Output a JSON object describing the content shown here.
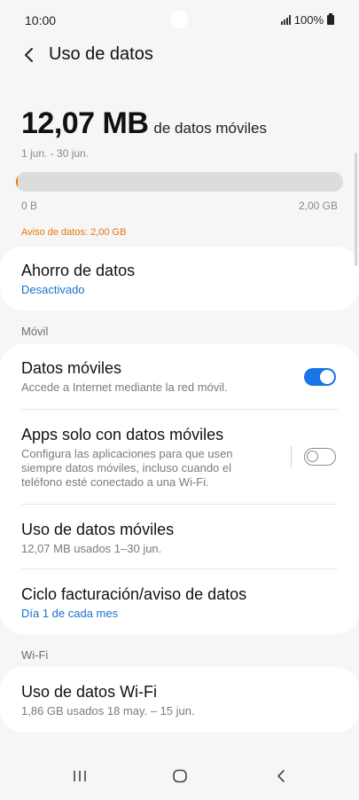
{
  "status": {
    "time": "10:00",
    "battery": "100%"
  },
  "header": {
    "title": "Uso de datos"
  },
  "usage": {
    "amount": "12,07 MB",
    "unit_text": "de datos móviles",
    "period": "1 jun. - 30 jun.",
    "progress_fraction": 0.006,
    "bar_min": "0 B",
    "bar_max": "2,00 GB",
    "warning": "Aviso de datos: 2,00 GB"
  },
  "data_saver": {
    "title": "Ahorro de datos",
    "status": "Desactivado"
  },
  "mobile": {
    "section_label": "Móvil",
    "mobile_data": {
      "title": "Datos móviles",
      "subtitle": "Accede a Internet mediante la red móvil.",
      "enabled": true
    },
    "mobile_only_apps": {
      "title": "Apps solo con datos móviles",
      "subtitle": "Configura las aplicaciones para que usen siempre datos móviles, incluso cuando el teléfono esté conectado a una Wi-Fi.",
      "enabled": false
    },
    "mobile_usage": {
      "title": "Uso de datos móviles",
      "subtitle": "12,07 MB usados 1–30 jun."
    },
    "billing": {
      "title": "Ciclo facturación/aviso de datos",
      "subtitle": "Día 1 de cada mes"
    }
  },
  "wifi": {
    "section_label": "Wi-Fi",
    "wifi_usage": {
      "title": "Uso de datos Wi-Fi",
      "subtitle": "1,86 GB usados 18 may. – 15 jun."
    }
  },
  "colors": {
    "accent": "#1a73e8",
    "link": "#1a73c9",
    "warning": "#e8760a",
    "background": "#f6f6f6"
  },
  "icons": {
    "back": "chevron-left-icon",
    "recent": "recent-apps-icon",
    "home": "home-icon",
    "nav_back": "back-icon"
  }
}
